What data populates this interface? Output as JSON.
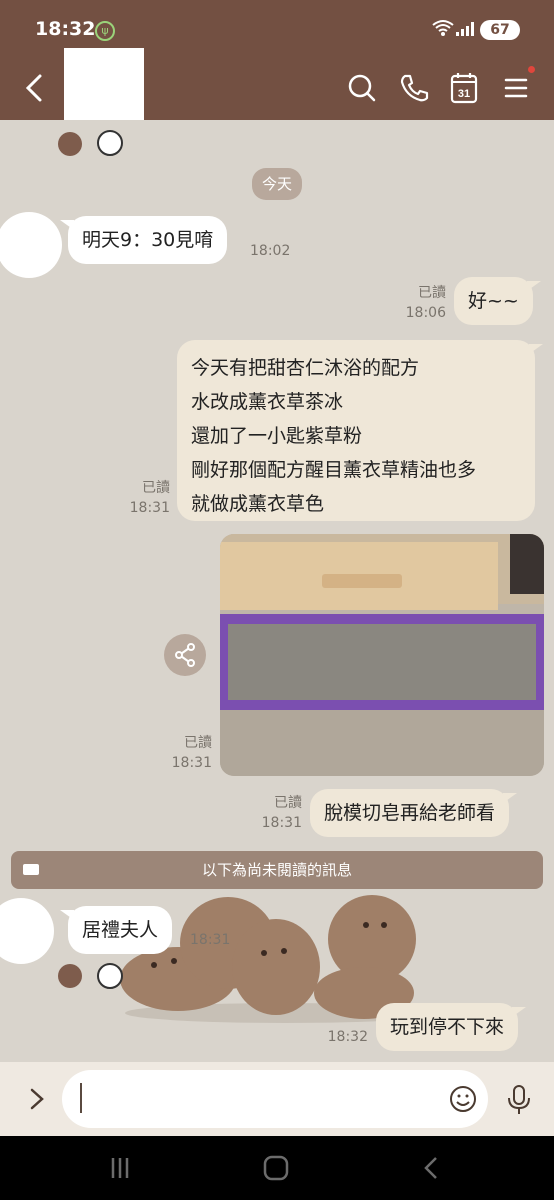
{
  "status_bar": {
    "time": "18:32",
    "battery": "67"
  },
  "header": {
    "icons": [
      "back-icon",
      "search-icon",
      "phone-icon",
      "calendar-icon",
      "menu-icon"
    ],
    "calendar_day": "31"
  },
  "chat": {
    "date_chip": "今天",
    "messages": [
      {
        "side": "left",
        "text": "明天9：30見唷",
        "time": "18:02"
      },
      {
        "side": "right",
        "read": "已讀",
        "time": "18:06",
        "text": "好~~"
      },
      {
        "side": "right",
        "read": "已讀",
        "time": "18:31",
        "lines": [
          "今天有把甜杏仁沐浴的配方",
          "水改成薰衣草茶冰",
          "還加了一小匙紫草粉",
          "剛好那個配方醒目薰衣草精油也多",
          "就做成薰衣草色"
        ]
      },
      {
        "side": "right",
        "read": "已讀",
        "time": "18:31",
        "type": "photo"
      },
      {
        "side": "right",
        "read": "已讀",
        "time": "18:31",
        "text": "脫模切皂再給老師看"
      },
      {
        "side": "left",
        "text": "居禮夫人",
        "time": "18:31"
      },
      {
        "side": "right",
        "time": "18:32",
        "text": "玩到停不下來"
      }
    ],
    "unread_divider": "以下為尚未閱讀的訊息"
  },
  "input_bar": {
    "placeholder": ""
  }
}
